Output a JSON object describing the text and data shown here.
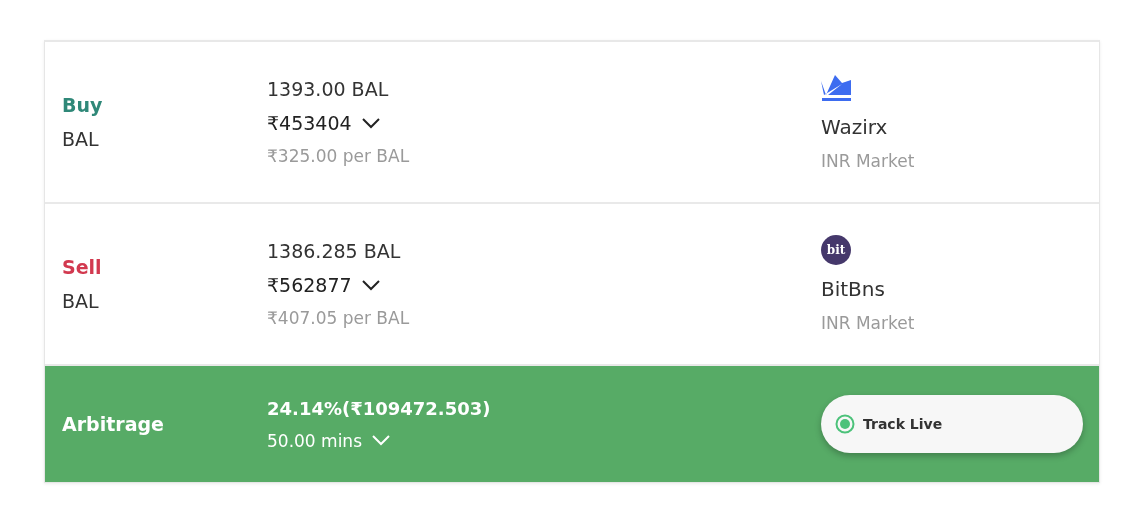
{
  "trades": [
    {
      "kind": "buy",
      "side": "Buy",
      "asset": "BAL",
      "amount": "1393.00 BAL",
      "total": "₹453404",
      "rate": "₹325.00 per BAL",
      "exchange": {
        "kind": "crown",
        "name": "Wazirx",
        "market": "INR Market"
      }
    },
    {
      "kind": "sell",
      "side": "Sell",
      "asset": "BAL",
      "amount": "1386.285 BAL",
      "total": "₹562877",
      "rate": "₹407.05 per BAL",
      "exchange": {
        "kind": "badge",
        "logo_text": "bit",
        "name": "BitBns",
        "market": "INR Market"
      }
    }
  ],
  "arbitrage": {
    "label": "Arbitrage",
    "profit": "24.14%(₹109472.503)",
    "duration": "50.00 mins",
    "button": "Track Live"
  }
}
